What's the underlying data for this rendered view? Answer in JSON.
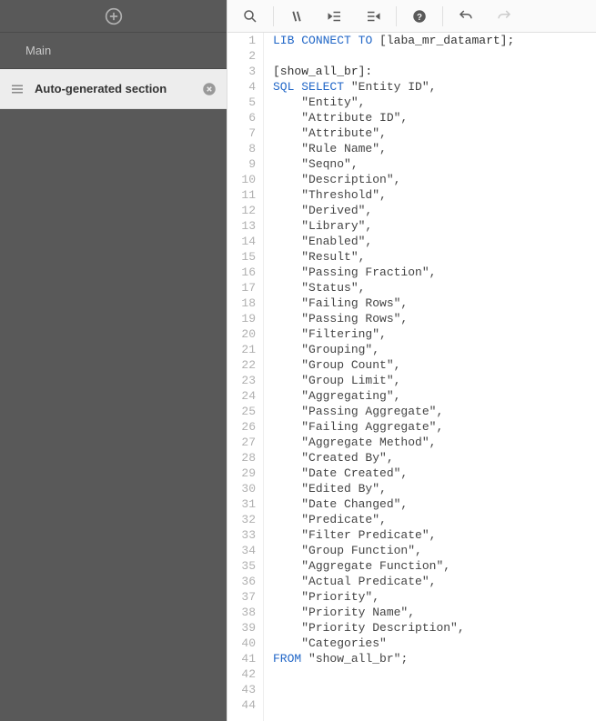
{
  "sidebar": {
    "tab_label": "Main",
    "section_label": "Auto-generated section"
  },
  "code": {
    "lib_connect": {
      "kw1": "LIB",
      "kw2": "CONNECT",
      "kw3": "TO",
      "target": "[laba_mr_datamart];"
    },
    "section_name": "[show_all_br]:",
    "sql_kw": "SQL",
    "select_kw": "SELECT",
    "first_field": "\"Entity ID\",",
    "fields": [
      "\"Entity\",",
      "\"Attribute ID\",",
      "\"Attribute\",",
      "\"Rule Name\",",
      "\"Seqno\",",
      "\"Description\",",
      "\"Threshold\",",
      "\"Derived\",",
      "\"Library\",",
      "\"Enabled\",",
      "\"Result\",",
      "\"Passing Fraction\",",
      "\"Status\",",
      "\"Failing Rows\",",
      "\"Passing Rows\",",
      "\"Filtering\",",
      "\"Grouping\",",
      "\"Group Count\",",
      "\"Group Limit\",",
      "\"Aggregating\",",
      "\"Passing Aggregate\",",
      "\"Failing Aggregate\",",
      "\"Aggregate Method\",",
      "\"Created By\",",
      "\"Date Created\",",
      "\"Edited By\",",
      "\"Date Changed\",",
      "\"Predicate\",",
      "\"Filter Predicate\",",
      "\"Group Function\",",
      "\"Aggregate Function\",",
      "\"Actual Predicate\",",
      "\"Priority\",",
      "\"Priority Name\",",
      "\"Priority Description\",",
      "\"Categories\""
    ],
    "from_kw": "FROM",
    "from_table": "\"show_all_br\";"
  },
  "line_count": 44
}
